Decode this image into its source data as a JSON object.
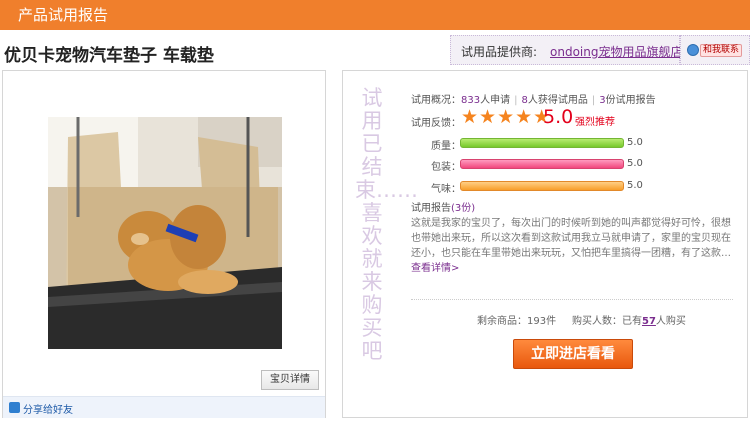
{
  "header": {
    "title": "产品试用报告"
  },
  "product": {
    "title": "优贝卡宠物汽车垫子 车载垫"
  },
  "supplier": {
    "label": "试用品提供商:",
    "name": "ondoing宠物用品旗舰店",
    "contact_label": "和我联系"
  },
  "gallery": {
    "detail_button": "宝贝详情",
    "share_label": "分享给好友"
  },
  "trial": {
    "status_vertical": "试用已结束……喜欢就来购买吧",
    "overview_label": "试用概况：",
    "applicants": "833",
    "applicants_suffix": "人申请",
    "winners": "8",
    "winners_suffix": "人获得试用品",
    "reports": "3",
    "reports_suffix": "份试用报告",
    "feedback_label": "试用反馈：",
    "stars": "★★★★★",
    "score": "5.0",
    "recommend": "强烈推荐",
    "ratings": [
      {
        "label": "质量：",
        "value": "5.0",
        "fill": 1.0
      },
      {
        "label": "包装：",
        "value": "5.0",
        "fill": 1.0
      },
      {
        "label": "气味：",
        "value": "5.0",
        "fill": 1.0
      }
    ],
    "report_title": "试用报告",
    "report_count": "(3份)",
    "report_text": "这就是我家的宝贝了，每次出门的时候听到她的叫声都觉得好可怜，很想也带她出来玩，所以这次看到这款试用我立马就申请了，家里的宝贝现在还小，也只能在车里带她出来玩玩，又怕把车里搞得一团糟，有了这款…",
    "more_link": "查看详情>",
    "remaining_label": "剩余商品：",
    "remaining": "193件",
    "buyers_label": "购买人数：已有",
    "buyers": "57",
    "buyers_suffix": "人购买",
    "cta": "立即进店看看"
  }
}
